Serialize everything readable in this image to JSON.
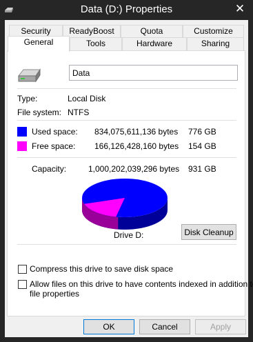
{
  "window": {
    "title": "Data (D:) Properties",
    "close_glyph": "✕"
  },
  "tabs": {
    "row1": [
      "Security",
      "ReadyBoost",
      "Quota",
      "Customize"
    ],
    "row2": [
      "General",
      "Tools",
      "Hardware",
      "Sharing"
    ],
    "active": "General"
  },
  "general": {
    "volume_name": "Data",
    "type_label": "Type:",
    "type_value": "Local Disk",
    "fs_label": "File system:",
    "fs_value": "NTFS",
    "used_label": "Used space:",
    "used_bytes": "834,075,611,136 bytes",
    "used_gb": "776 GB",
    "free_label": "Free space:",
    "free_bytes": "166,126,428,160 bytes",
    "free_gb": "154 GB",
    "capacity_label": "Capacity:",
    "capacity_bytes": "1,000,202,039,296 bytes",
    "capacity_gb": "931 GB",
    "drive_label": "Drive D:",
    "cleanup_button": "Disk Cleanup",
    "compress_label": "Compress this drive to save disk space",
    "index_label_line1": "Allow files on this drive to have contents indexed in addition to",
    "index_label_line2": "file properties",
    "compress_checked": false,
    "index_checked": false
  },
  "colors": {
    "used": "#0000ff",
    "free": "#ff00ff"
  },
  "chart_data": {
    "type": "pie",
    "categories": [
      "Used space",
      "Free space"
    ],
    "values": [
      834075611136,
      166126428160
    ]
  },
  "footer": {
    "ok": "OK",
    "cancel": "Cancel",
    "apply": "Apply"
  }
}
